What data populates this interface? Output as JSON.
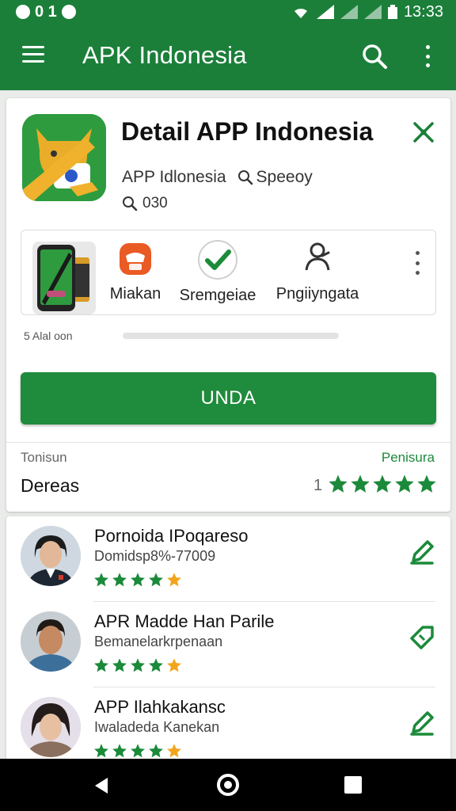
{
  "status_bar": {
    "time": "13:33",
    "left_glyphs": "0 1"
  },
  "app_bar": {
    "title": "APK Indonesia",
    "icons": [
      "menu-icon",
      "search-icon",
      "more-vert-icon"
    ]
  },
  "app_detail": {
    "title": "Detail  APP Indonesia",
    "developer": "APP Idlonesia",
    "category": "Speeoy",
    "size": "030",
    "features": [
      {
        "label": "",
        "icon": "phone-thumbnail"
      },
      {
        "label": "Miakan",
        "icon": "orange-app-icon"
      },
      {
        "label": "Sremgeiae",
        "icon": "check-icon"
      },
      {
        "label": "Pngiiyngata",
        "icon": "person-icon"
      }
    ],
    "progress_label": "5 Alal oon",
    "progress_fraction": 0,
    "install_label": "UNDA"
  },
  "rating": {
    "caption": "Tonisun",
    "link": "Penisura",
    "title": "Dereas",
    "count": "1",
    "stars": 5
  },
  "reviews": [
    {
      "name": "Pornoida IPoqareso",
      "sub": "Domidsp8%-77009",
      "stars": 5
    },
    {
      "name": "APR Madde Han Parile",
      "sub": "Bemanelarkrpenaan",
      "stars": 5
    },
    {
      "name": "APP Ilahkakansc",
      "sub": "Iwaladeda Kanekan",
      "stars": 5
    }
  ],
  "colors": {
    "brand_green": "#1b7f3a",
    "button_green": "#1f8b3c",
    "star_green": "#1b8a3a",
    "star_gold": "#f2a51c"
  }
}
